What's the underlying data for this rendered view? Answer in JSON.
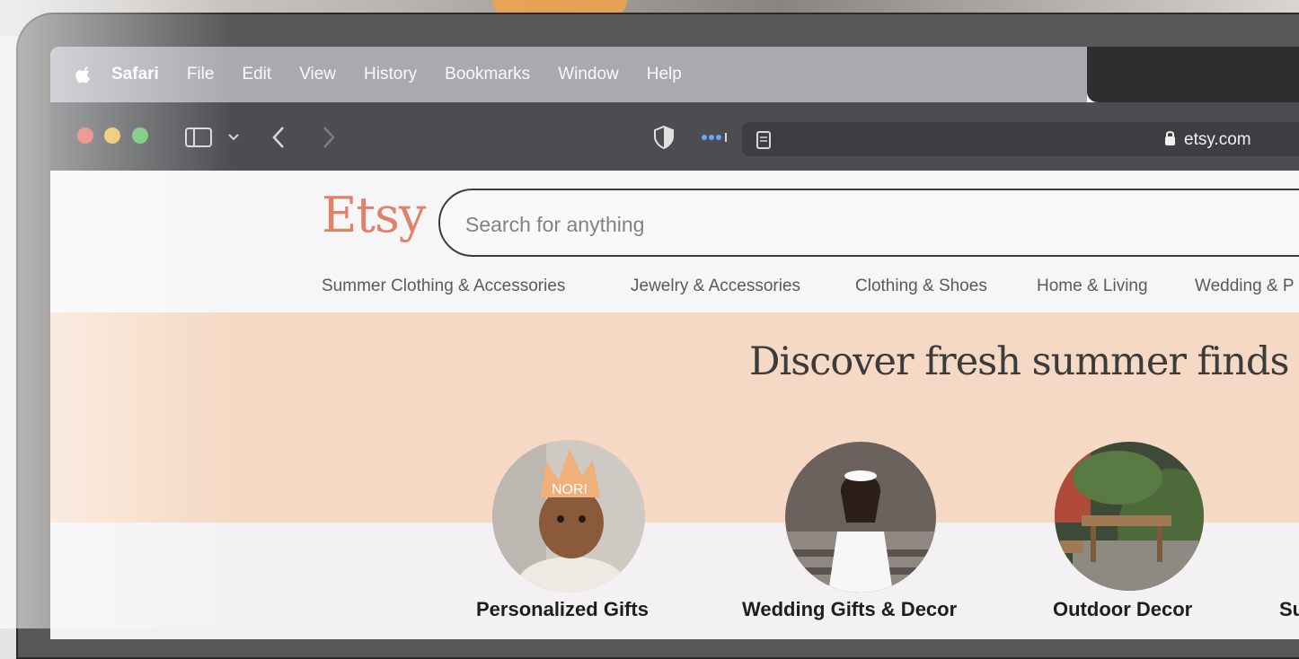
{
  "menubar": {
    "app": "Safari",
    "items": [
      "File",
      "Edit",
      "View",
      "History",
      "Bookmarks",
      "Window",
      "Help"
    ]
  },
  "toolbar": {
    "url": "etsy.com"
  },
  "etsy": {
    "logo": "Etsy",
    "search_placeholder": "Search for anything",
    "categories": [
      "Summer Clothing & Accessories",
      "Jewelry & Accessories",
      "Clothing & Shoes",
      "Home & Living",
      "Wedding & P"
    ],
    "hero_title": "Discover fresh summer finds f",
    "circles": [
      {
        "label": "Personalized Gifts"
      },
      {
        "label": "Wedding Gifts & Decor"
      },
      {
        "label": "Outdoor Decor"
      },
      {
        "label": "Su"
      }
    ],
    "crown_text": "NORI"
  },
  "colors": {
    "etsy_orange": "#e0826a",
    "hero_peach": "#f5d9c4"
  }
}
